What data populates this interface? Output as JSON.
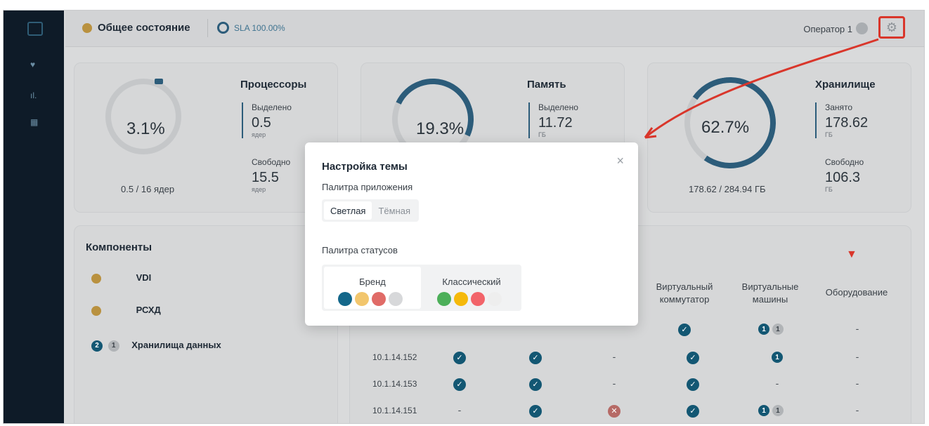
{
  "header": {
    "title": "Общее состояние",
    "sla": "SLA 100.00%",
    "user": "Оператор 1"
  },
  "cards": {
    "cpu": {
      "title": "Процессоры",
      "percent": "3.1%",
      "summary": "0.5 / 16 ядер",
      "alloc_label": "Выделено",
      "alloc_value": "0.5",
      "alloc_unit": "ядер",
      "free_label": "Свободно",
      "free_value": "15.5",
      "free_unit": "ядер"
    },
    "mem": {
      "title": "Память",
      "percent": "19.3%",
      "alloc_label": "Выделено",
      "alloc_value": "11.72",
      "alloc_unit": "ГБ"
    },
    "storage": {
      "title": "Хранилище",
      "percent": "62.7%",
      "summary": "178.62 / 284.94 ГБ",
      "used_label": "Занято",
      "used_value": "178.62",
      "used_unit": "ГБ",
      "free_label": "Свободно",
      "free_value": "106.3",
      "free_unit": "ГБ"
    }
  },
  "components": {
    "title": "Компоненты",
    "items": [
      {
        "label": "VDI"
      },
      {
        "label": "РСХД"
      },
      {
        "label": "Хранилища данных",
        "badge_blue": "2",
        "badge_grey": "1"
      }
    ]
  },
  "table": {
    "headers": [
      "Виртуальный\nкоммутатор",
      "Виртуальные\nмашины",
      "Оборудование"
    ],
    "rows": [
      {
        "ip": "",
        "vm_blue": "1",
        "vm_grey": "1",
        "hw": "-"
      },
      {
        "ip": "10.1.14.152",
        "c3": "-",
        "vm_blue": "1",
        "hw": "-"
      },
      {
        "ip": "10.1.14.153",
        "c3": "-",
        "vm": "-",
        "hw": "-"
      },
      {
        "ip": "10.1.14.151",
        "c1": "-",
        "vm_blue": "1",
        "vm_grey": "1",
        "hw": "-"
      }
    ]
  },
  "modal": {
    "title": "Настройка темы",
    "app_palette_label": "Палитра приложения",
    "app_palette_options": [
      "Светлая",
      "Тёмная"
    ],
    "status_palette_label": "Палитра статусов",
    "status_palettes": [
      {
        "name": "Бренд",
        "colors": [
          "#13678a",
          "#f2c66d",
          "#e06b67",
          "#d7d8da"
        ]
      },
      {
        "name": "Классический",
        "colors": [
          "#4caf59",
          "#f5b90a",
          "#f2646a",
          "#eeeeee"
        ]
      }
    ]
  },
  "icons": {
    "close": "×",
    "gear": "⚙",
    "chevron": "▼"
  }
}
